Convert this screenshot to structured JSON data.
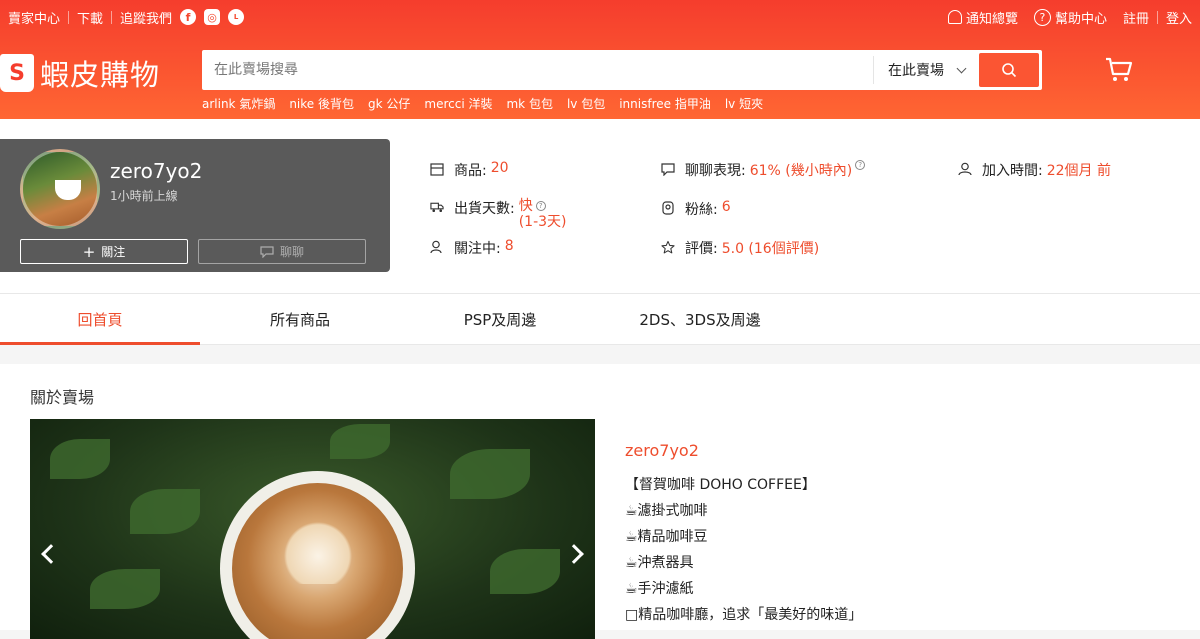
{
  "topbar": {
    "seller_center": "賣家中心",
    "download": "下載",
    "follow_us": "追蹤我們",
    "notifications": "通知總覽",
    "help": "幫助中心",
    "register": "註冊",
    "login": "登入"
  },
  "header": {
    "logo_text": "蝦皮購物",
    "search_placeholder": "在此賣場搜尋",
    "search_scope": "在此賣場",
    "hints": [
      "arlink 氣炸鍋",
      "nike 後背包",
      "gk 公仔",
      "mercci 洋裝",
      "mk 包包",
      "lv 包包",
      "innisfree 指甲油",
      "lv 短夾"
    ],
    "accent": "#ee4d2d"
  },
  "shop": {
    "name": "zero7yo2",
    "online": "1小時前上線",
    "follow_label": "關注",
    "chat_label": "聊聊"
  },
  "stats": {
    "products_label": "商品:",
    "products_value": "20",
    "chat_label": "聊聊表現:",
    "chat_value": "61% (幾小時內)",
    "joined_label": "加入時間:",
    "joined_value": "22個月 前",
    "ship_label": "出貨天數:",
    "ship_value": "快",
    "ship_value2": "(1-3天)",
    "fans_label": "粉絲:",
    "fans_value": "6",
    "following_label": "關注中:",
    "following_value": "8",
    "rating_label": "評價:",
    "rating_value": "5.0 (16個評價)"
  },
  "tabs": [
    {
      "label": "回首頁"
    },
    {
      "label": "所有商品"
    },
    {
      "label": "PSP及周邊"
    },
    {
      "label": "2DS、3DS及周邊"
    }
  ],
  "about": {
    "title": "關於賣場",
    "shop_name": "zero7yo2",
    "lines": [
      "【督賀咖啡 DOHO COFFEE】",
      "☕濾掛式咖啡",
      "☕精品咖啡豆",
      "☕沖煮器具",
      "☕手沖濾紙",
      "□精品咖啡廳，追求「最美好的味道」"
    ]
  }
}
